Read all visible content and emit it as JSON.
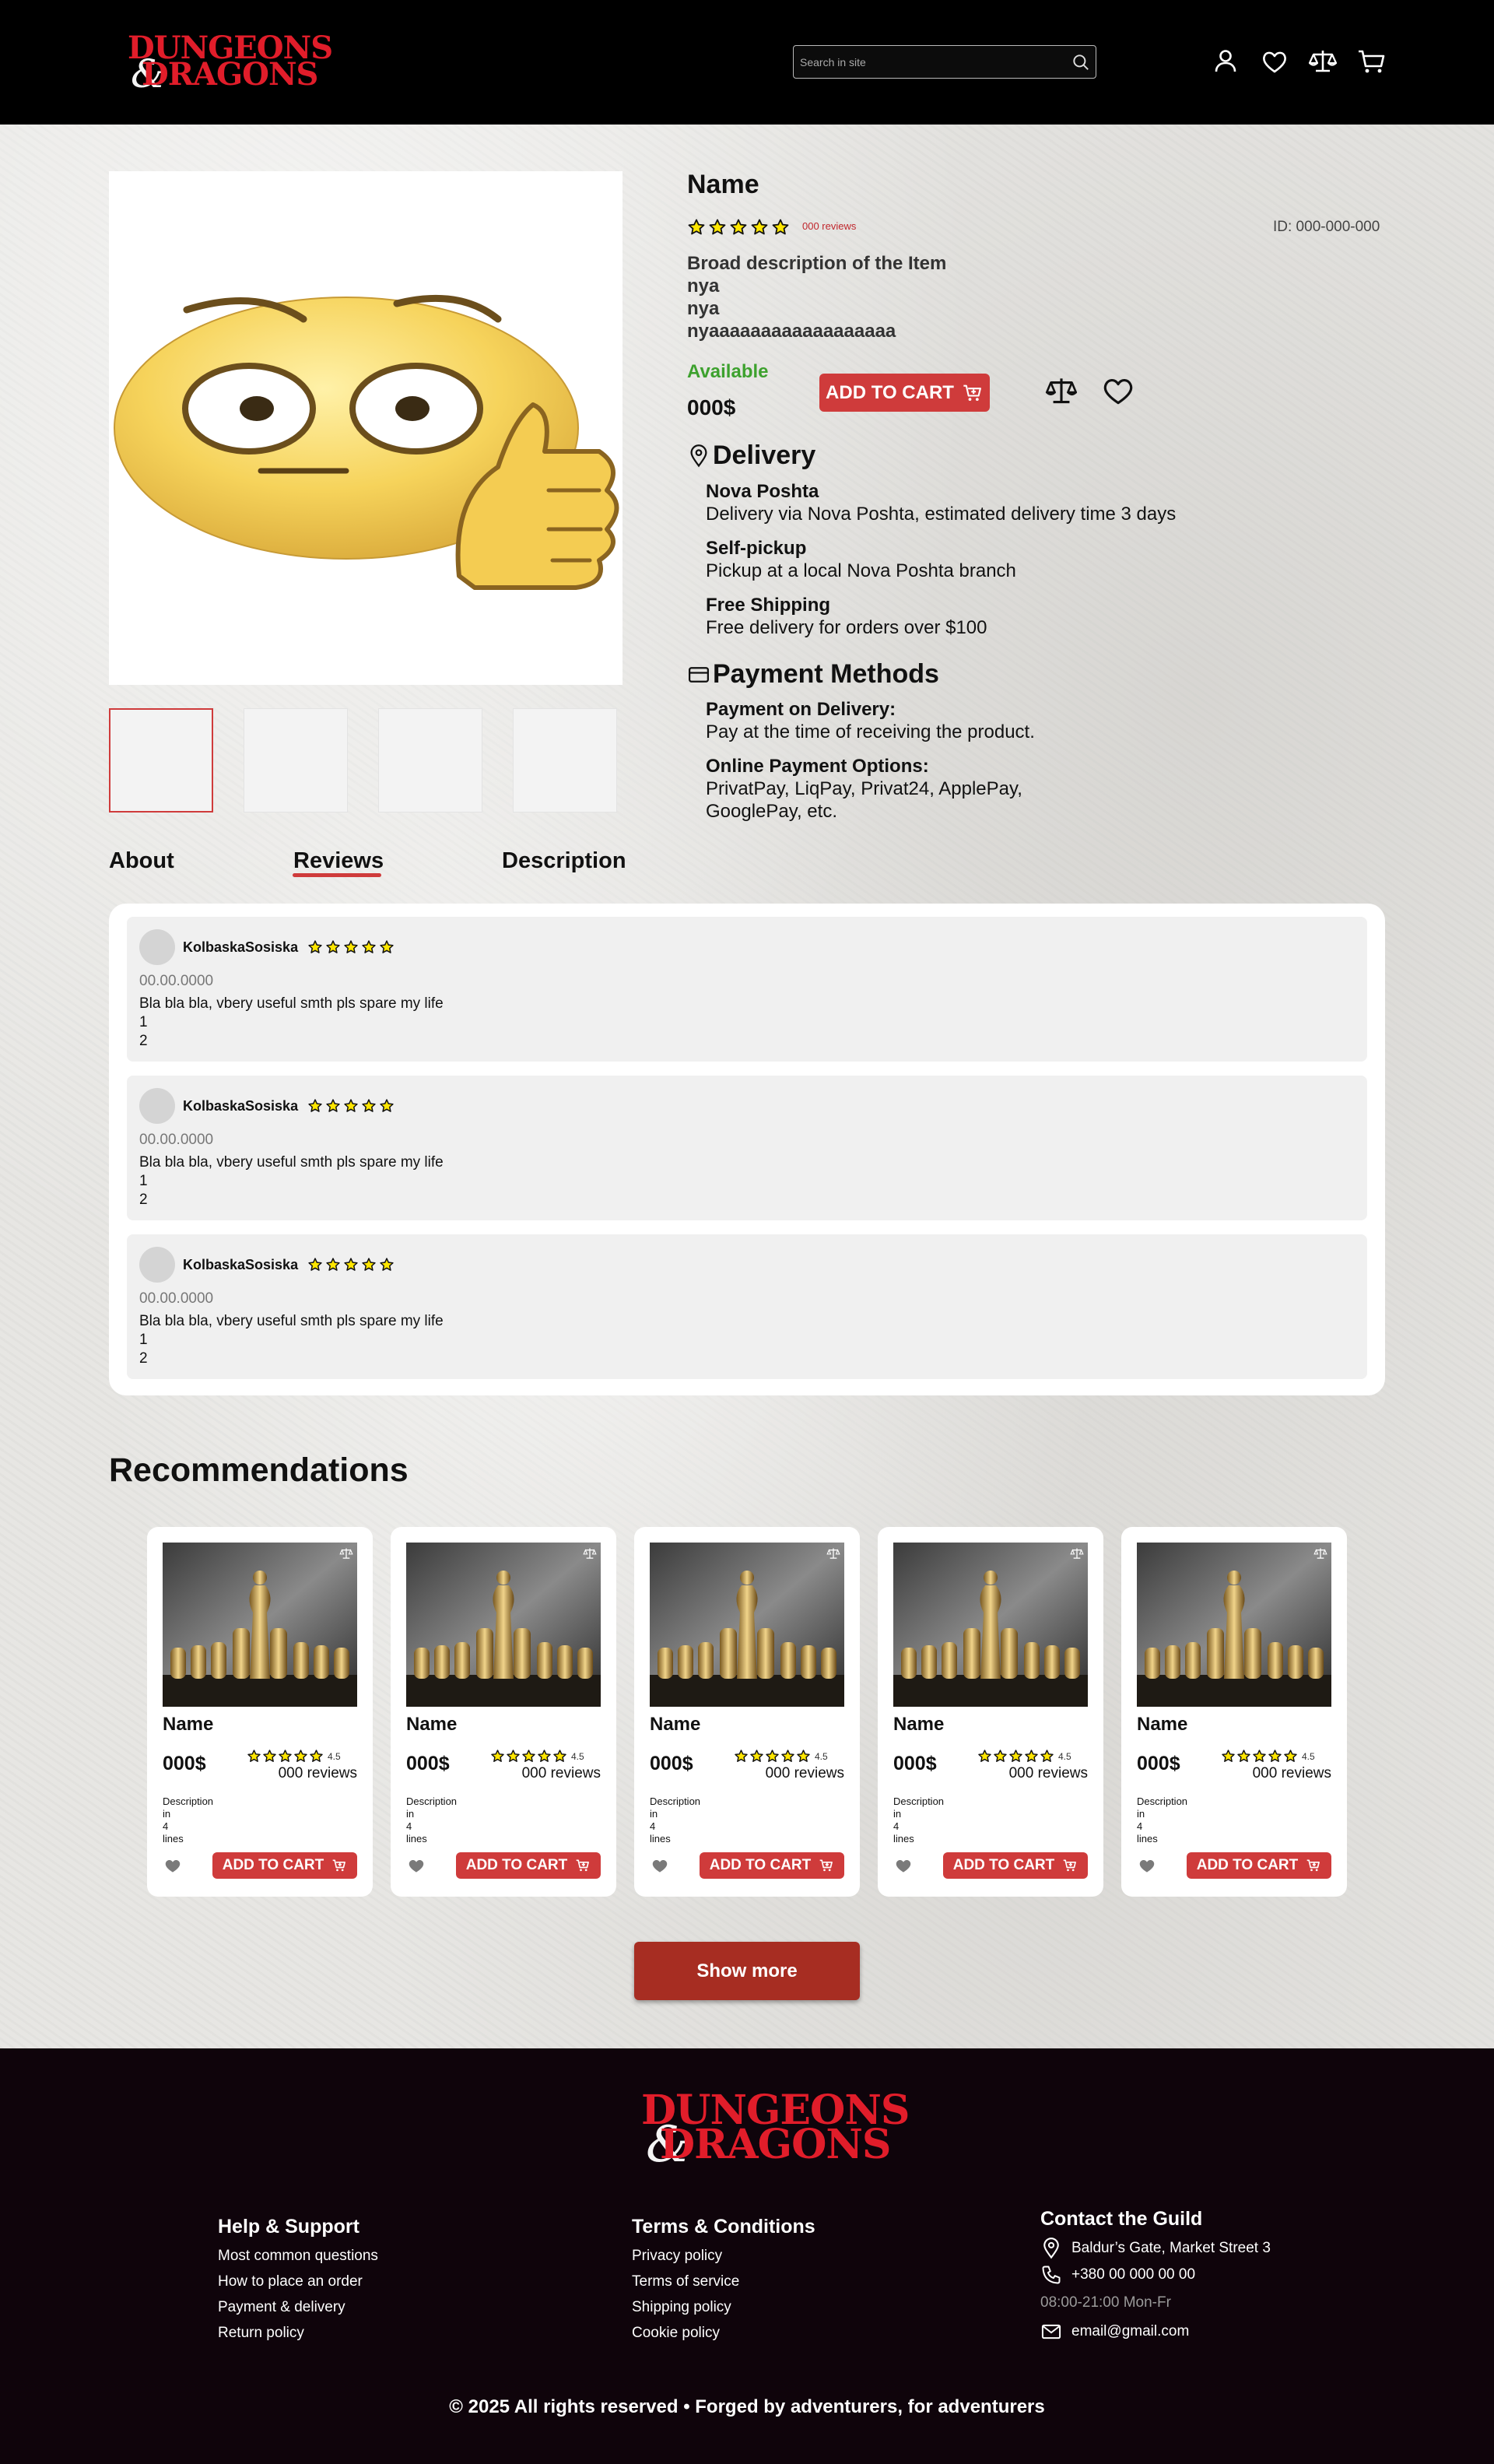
{
  "header": {
    "logo_top": "DUNGEONS",
    "logo_amp": "&",
    "logo_bottom": "DRAGONS",
    "search_placeholder": "Search in site",
    "icons": [
      "user-icon",
      "heart-icon",
      "compare-icon",
      "cart-icon"
    ]
  },
  "product": {
    "name": "Name",
    "rating_stars": 5,
    "reviews_label": "000 reviews",
    "id_label": "ID: 000-000-000",
    "description_title": "Broad description of the Item",
    "description_lines": [
      "nya",
      "nya",
      "nyaaaaaaaaaaaaaaaaaa"
    ],
    "availability": "Available",
    "price": "000$",
    "add_to_cart": "ADD TO CART",
    "delivery": {
      "title": "Delivery",
      "options": [
        {
          "title": "Nova Poshta",
          "desc": "Delivery via Nova Poshta, estimated delivery time 3 days"
        },
        {
          "title": "Self-pickup",
          "desc": "Pickup at a local Nova Poshta branch"
        },
        {
          "title": "Free Shipping",
          "desc": "Free delivery for orders over $100"
        }
      ]
    },
    "payment": {
      "title": "Payment Methods",
      "options": [
        {
          "title": "Payment on Delivery:",
          "desc": "Pay at the time of receiving the product."
        },
        {
          "title": "Online Payment Options:",
          "desc1": "PrivatPay, LiqPay, Privat24, ApplePay,",
          "desc2": "GooglePay, etc."
        }
      ]
    }
  },
  "tabs": [
    {
      "label": "About",
      "active": false
    },
    {
      "label": "Reviews",
      "active": true
    },
    {
      "label": "Description",
      "active": false
    }
  ],
  "reviews": [
    {
      "user": "KolbaskaSosiska",
      "stars": 5,
      "date": "00.00.0000",
      "text": "Bla bla bla, vbery useful smth pls spare my life",
      "line1": "1",
      "line2": "2"
    },
    {
      "user": "KolbaskaSosiska",
      "stars": 5,
      "date": "00.00.0000",
      "text": "Bla bla bla, vbery useful smth pls spare my life",
      "line1": "1",
      "line2": "2"
    },
    {
      "user": "KolbaskaSosiska",
      "stars": 5,
      "date": "00.00.0000",
      "text": "Bla bla bla, vbery useful smth pls spare my life",
      "line1": "1",
      "line2": "2"
    }
  ],
  "recommendations": {
    "title": "Recommendations",
    "show_more": "Show more",
    "items": [
      {
        "name": "Name",
        "price": "000$",
        "rating": "4.5",
        "reviews": "000 reviews",
        "desc": [
          "Description",
          "in",
          "4",
          "lines"
        ],
        "cart": "ADD TO CART"
      },
      {
        "name": "Name",
        "price": "000$",
        "rating": "4.5",
        "reviews": "000 reviews",
        "desc": [
          "Description",
          "in",
          "4",
          "lines"
        ],
        "cart": "ADD TO CART"
      },
      {
        "name": "Name",
        "price": "000$",
        "rating": "4.5",
        "reviews": "000 reviews",
        "desc": [
          "Description",
          "in",
          "4",
          "lines"
        ],
        "cart": "ADD TO CART"
      },
      {
        "name": "Name",
        "price": "000$",
        "rating": "4.5",
        "reviews": "000 reviews",
        "desc": [
          "Description",
          "in",
          "4",
          "lines"
        ],
        "cart": "ADD TO CART"
      },
      {
        "name": "Name",
        "price": "000$",
        "rating": "4.5",
        "reviews": "000 reviews",
        "desc": [
          "Description",
          "in",
          "4",
          "lines"
        ],
        "cart": "ADD TO CART"
      }
    ]
  },
  "footer": {
    "logo_top": "DUNGEONS",
    "logo_amp": "&",
    "logo_bottom": "DRAGONS",
    "help": {
      "title": "Help & Support",
      "links": [
        "Most common questions",
        "How to place an order",
        "Payment & delivery",
        "Return policy"
      ]
    },
    "terms": {
      "title": "Terms & Conditions",
      "links": [
        "Privacy policy",
        "Terms of service",
        "Shipping policy",
        "Cookie policy"
      ]
    },
    "contact": {
      "title": "Contact the Guild",
      "address": "Baldur’s Gate, Market Street 3",
      "phone": "+380 00 000 00 00",
      "hours": "08:00-21:00 Mon-Fr",
      "email": "email@gmail.com"
    },
    "copyright": "© 2025 All rights reserved • Forged by adventurers, for adventurers"
  },
  "colors": {
    "accent": "#cf3b3b",
    "available": "#3da12e",
    "footer_bg": "#0f040b",
    "show_more": "#a72d22"
  }
}
